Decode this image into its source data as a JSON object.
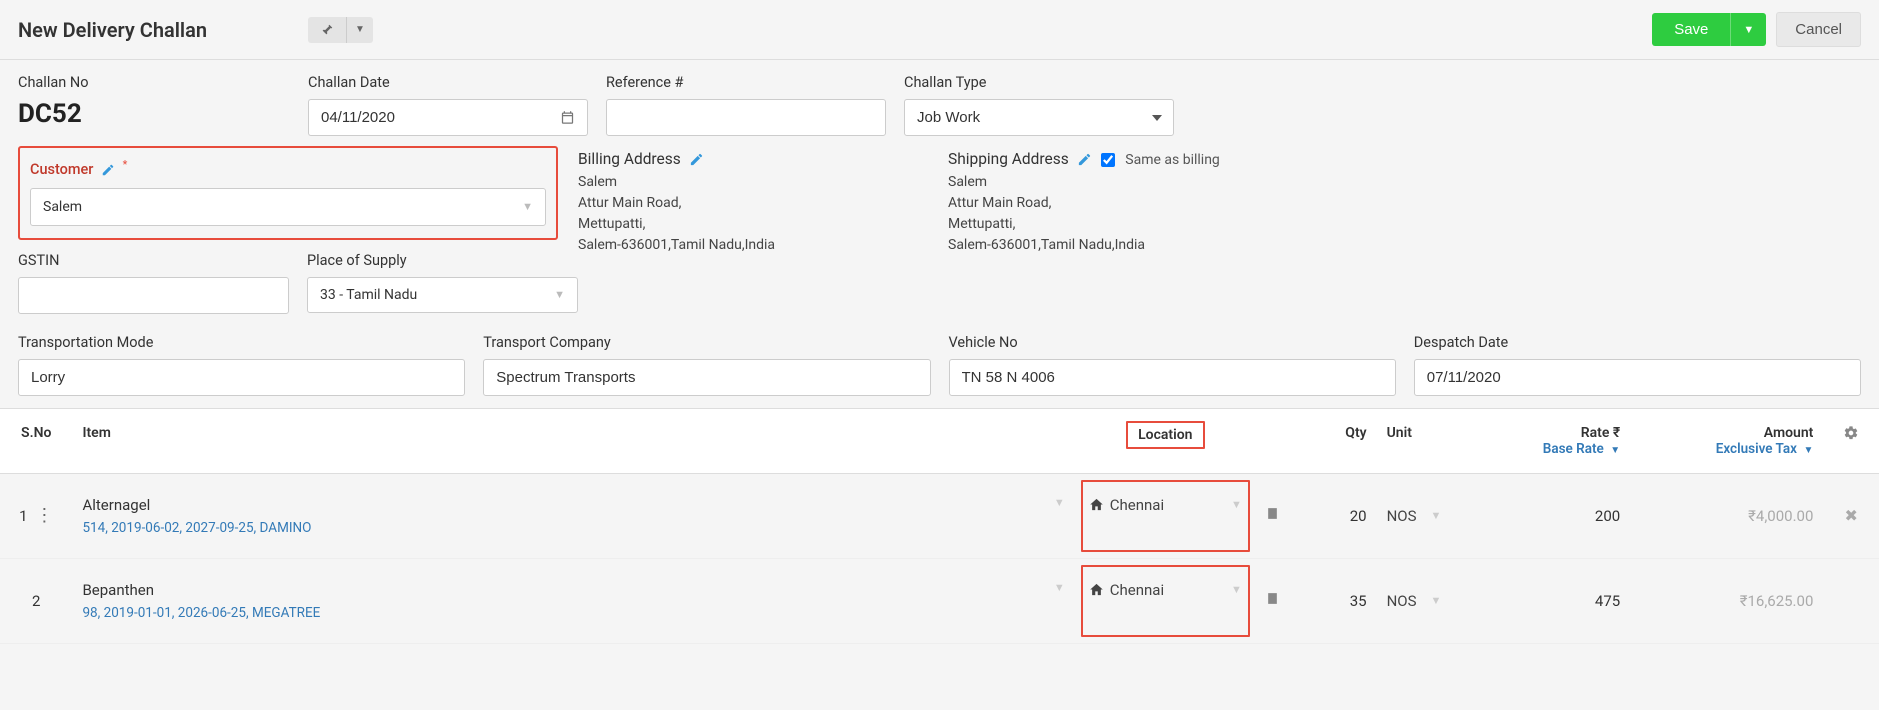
{
  "header": {
    "title": "New Delivery Challan",
    "save_label": "Save",
    "cancel_label": "Cancel"
  },
  "form": {
    "challan_no_label": "Challan No",
    "challan_no_value": "DC52",
    "challan_date_label": "Challan Date",
    "challan_date_value": "04/11/2020",
    "reference_label": "Reference #",
    "reference_value": "",
    "challan_type_label": "Challan Type",
    "challan_type_value": "Job Work",
    "customer_label": "Customer",
    "customer_value": "Salem",
    "gstin_label": "GSTIN",
    "gstin_value": "",
    "place_of_supply_label": "Place of Supply",
    "place_of_supply_value": "33 - Tamil Nadu",
    "billing_address_label": "Billing Address",
    "shipping_address_label": "Shipping Address",
    "same_as_billing_label": "Same as billing",
    "billing_address": {
      "name": "Salem",
      "line1": "Attur Main Road,",
      "line2": "Mettupatti,",
      "line3": "Salem-636001,Tamil Nadu,India"
    },
    "shipping_address": {
      "name": "Salem",
      "line1": "Attur Main Road,",
      "line2": "Mettupatti,",
      "line3": "Salem-636001,Tamil Nadu,India"
    },
    "transport_mode_label": "Transportation Mode",
    "transport_mode_value": "Lorry",
    "transport_company_label": "Transport Company",
    "transport_company_value": "Spectrum Transports",
    "vehicle_no_label": "Vehicle No",
    "vehicle_no_value": "TN 58 N 4006",
    "despatch_date_label": "Despatch Date",
    "despatch_date_value": "07/11/2020"
  },
  "table": {
    "headers": {
      "sno": "S.No",
      "item": "Item",
      "location": "Location",
      "qty": "Qty",
      "unit": "Unit",
      "rate": "Rate ₹",
      "rate_sub": "Base Rate",
      "amount": "Amount",
      "amount_sub": "Exclusive Tax"
    },
    "rows": [
      {
        "sno": "1",
        "item_name": "Alternagel",
        "item_detail": "514, 2019-06-02, 2027-09-25, DAMINO",
        "location": "Chennai",
        "qty": "20",
        "unit": "NOS",
        "rate": "200",
        "amount": "₹4,000.00"
      },
      {
        "sno": "2",
        "item_name": "Bepanthen",
        "item_detail": "98, 2019-01-01, 2026-06-25, MEGATREE",
        "location": "Chennai",
        "qty": "35",
        "unit": "NOS",
        "rate": "475",
        "amount": "₹16,625.00"
      }
    ]
  }
}
